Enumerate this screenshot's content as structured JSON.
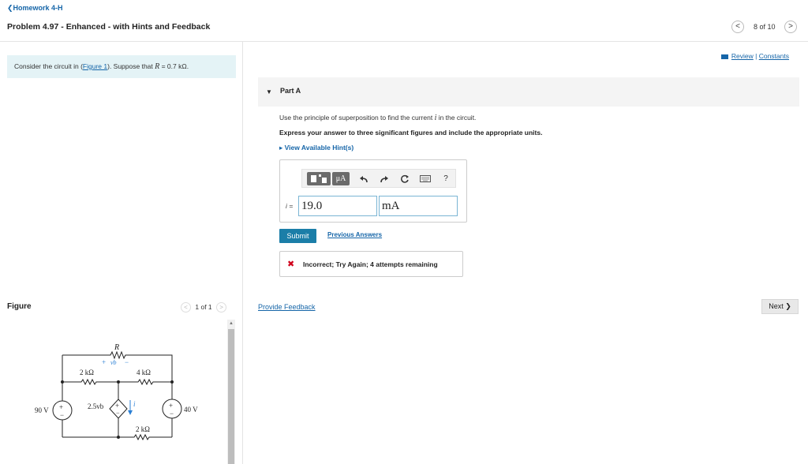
{
  "header": {
    "back_link": "❮Homework 4-H",
    "problem_title": "Problem 4.97 - Enhanced - with Hints and Feedback",
    "pager_text": "8 of 10",
    "prev_glyph": "<",
    "next_glyph": ">"
  },
  "left": {
    "context_prefix": "Consider the circuit in (",
    "context_link": "Figure 1",
    "context_suffix": "). Suppose that ",
    "context_var": "R",
    "context_value": " = 0.7 kΩ.",
    "figure_label": "Figure",
    "figure_pager": "1 of 1"
  },
  "right": {
    "review_link": "Review",
    "separator": " | ",
    "constants_link": "Constants",
    "part_label": "Part A",
    "question_prefix": "Use the principle of superposition to find the current ",
    "question_var": "i",
    "question_suffix": " in the circuit.",
    "instruction": "Express your answer to three significant figures and include the appropriate units.",
    "hints_link": "▸ View Available Hint(s)",
    "answer_var": "i =",
    "answer_value": "19.0",
    "answer_units": "mA",
    "toolbar": {
      "units_btn": "μA",
      "help_btn": "?"
    },
    "submit_label": "Submit",
    "previous_answers": "Previous Answers",
    "feedback_mark": "✖",
    "feedback_text": "Incorrect; Try Again; 4 attempts remaining",
    "provide_feedback": "Provide Feedback",
    "next_label": "Next ❯"
  },
  "circuit": {
    "r_label": "R",
    "vb_plus": "+",
    "vb_label": "vb",
    "vb_minus": "−",
    "r_left": "2 kΩ",
    "r_mid": "4 kΩ",
    "r_bottom": "2 kΩ",
    "source_left": "90 V",
    "source_right": "40 V",
    "dep_source": "2.5vb",
    "current_label": "i"
  },
  "colors": {
    "accent": "#1565a8",
    "submit": "#1b7ea8",
    "context_bg": "#e4f3f6",
    "error": "#d0021b"
  }
}
